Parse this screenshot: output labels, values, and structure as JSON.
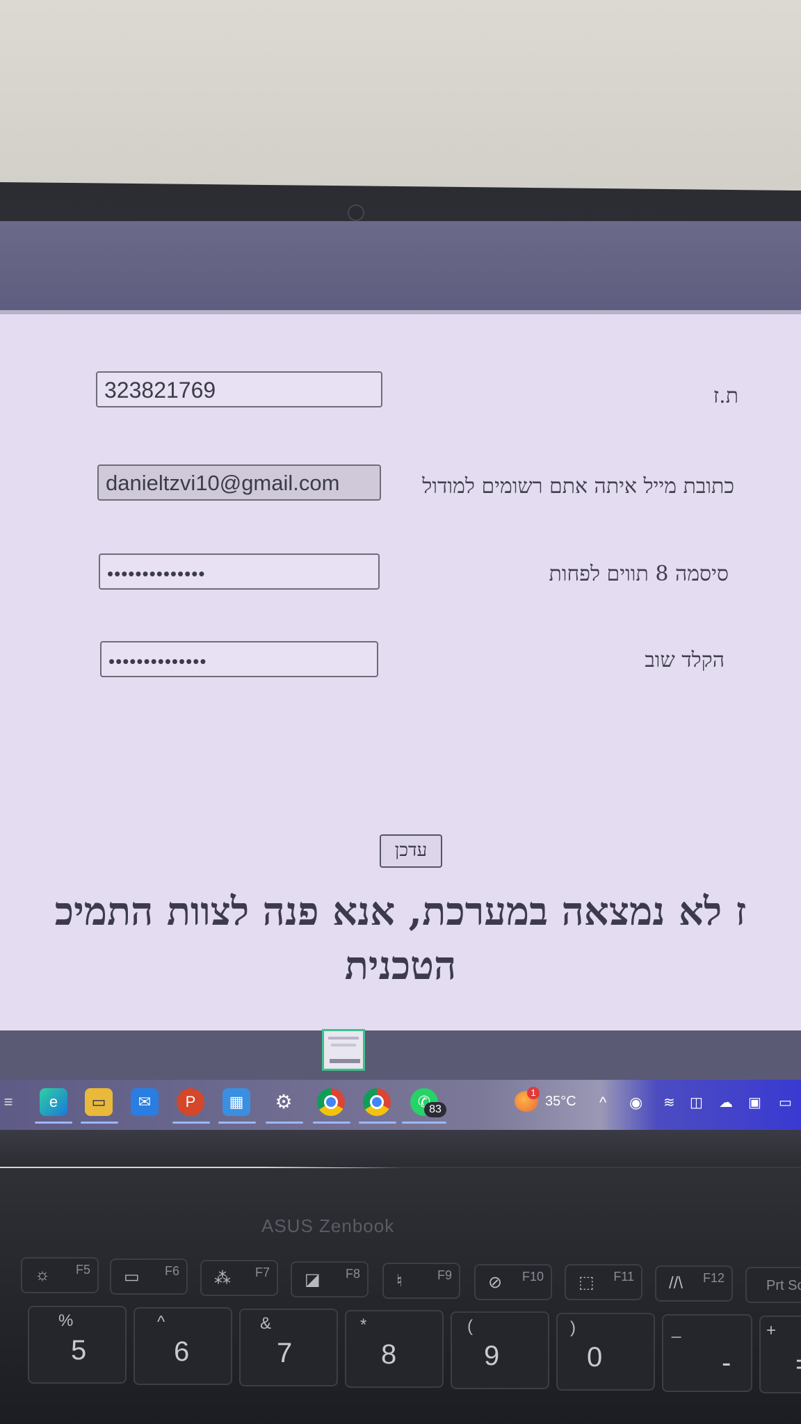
{
  "form": {
    "id_label": "ת.ז",
    "id_value": "323821769",
    "email_label": "כתובת מייל איתה אתם רשומים למודול",
    "email_value": "danieltzvi10@gmail.com",
    "password_label": "סיסמה 8 תווים לפחות",
    "password_mask": "••••••••••••••",
    "confirm_label": "הקלד שוב",
    "confirm_mask": "••••••••••••••",
    "submit_label": "עדכן"
  },
  "message": {
    "line1": "ז לא נמצאה במערכת, אנא פנה לצוות התמיכ",
    "line2": "הטכנית"
  },
  "taskbar": {
    "apps": [
      "edge-icon",
      "file-explorer-icon",
      "mail-icon",
      "powerpoint-icon",
      "app-icon",
      "settings-icon",
      "chrome-icon",
      "chrome-icon",
      "whatsapp-icon"
    ],
    "whatsapp_badge": "83",
    "weather_badge": "1",
    "temperature": "35°C"
  },
  "laptop": {
    "brand": "ASUS Zenbook",
    "fkeys": [
      "F5",
      "F6",
      "F7",
      "F8",
      "F9",
      "F10",
      "F11",
      "F12",
      "Prt Sc"
    ],
    "numkeys": [
      {
        "main": "5",
        "shift": "%"
      },
      {
        "main": "6",
        "shift": "^"
      },
      {
        "main": "7",
        "shift": "&"
      },
      {
        "main": "8",
        "shift": "*"
      },
      {
        "main": "9",
        "shift": "("
      },
      {
        "main": "0",
        "shift": ")"
      },
      {
        "main": "-",
        "shift": "_"
      },
      {
        "main": "=",
        "shift": "+"
      }
    ]
  }
}
